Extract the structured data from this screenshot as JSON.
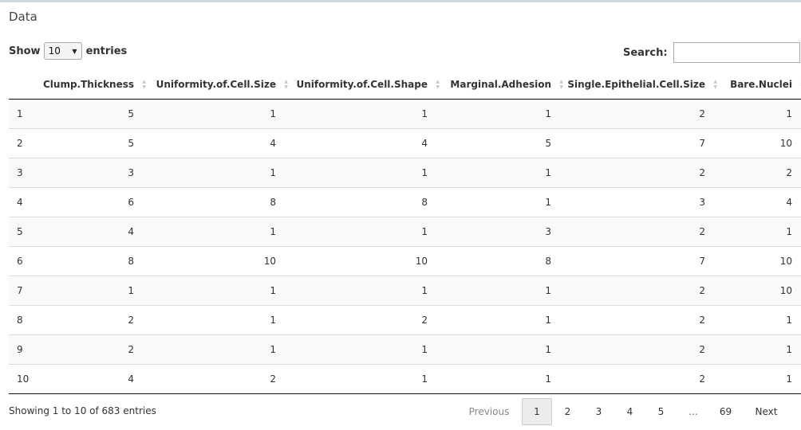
{
  "box": {
    "title": "Data"
  },
  "length_menu": {
    "show_label": "Show",
    "value": "10",
    "entries_label": "entries"
  },
  "search": {
    "label": "Search:",
    "value": "",
    "placeholder": ""
  },
  "table": {
    "columns": [
      "",
      "Clump.Thickness",
      "Uniformity.of.Cell.Size",
      "Uniformity.of.Cell.Shape",
      "Marginal.Adhesion",
      "Single.Epithelial.Cell.Size",
      "Bare.Nuclei"
    ],
    "rows": [
      [
        "1",
        "5",
        "1",
        "1",
        "1",
        "2",
        "1"
      ],
      [
        "2",
        "5",
        "4",
        "4",
        "5",
        "7",
        "10"
      ],
      [
        "3",
        "3",
        "1",
        "1",
        "1",
        "2",
        "2"
      ],
      [
        "4",
        "6",
        "8",
        "8",
        "1",
        "3",
        "4"
      ],
      [
        "5",
        "4",
        "1",
        "1",
        "3",
        "2",
        "1"
      ],
      [
        "6",
        "8",
        "10",
        "10",
        "8",
        "7",
        "10"
      ],
      [
        "7",
        "1",
        "1",
        "1",
        "1",
        "2",
        "10"
      ],
      [
        "8",
        "2",
        "1",
        "2",
        "1",
        "2",
        "1"
      ],
      [
        "9",
        "2",
        "1",
        "1",
        "1",
        "2",
        "1"
      ],
      [
        "10",
        "4",
        "2",
        "1",
        "1",
        "2",
        "1"
      ]
    ]
  },
  "info": {
    "text": "Showing 1 to 10 of 683 entries"
  },
  "pagination": {
    "previous": "Previous",
    "pages": [
      "1",
      "2",
      "3",
      "4",
      "5"
    ],
    "ellipsis": "…",
    "last_page": "69",
    "next": "Next",
    "current": "1"
  },
  "icons": {
    "sort": "sort-both-icon",
    "dropdown": "caret-down-icon"
  },
  "colors": {
    "header_border": "#111111",
    "stripe": "#f9f9f9",
    "current_page_bg": "#ececec",
    "top_border": "#d2d6de"
  }
}
